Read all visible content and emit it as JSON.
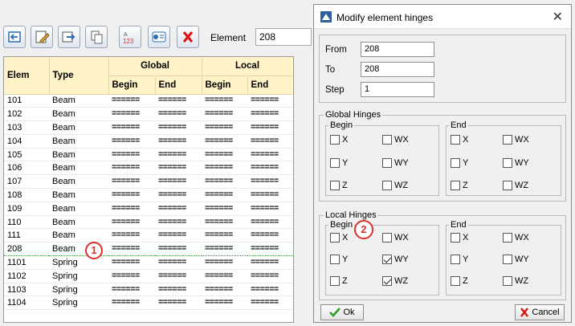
{
  "toolbar": {
    "element_label": "Element",
    "element_value": "208"
  },
  "grid": {
    "headers": {
      "elem": "Elem",
      "type": "Type",
      "global": "Global",
      "local": "Local",
      "begin": "Begin",
      "end": "End"
    },
    "rows": [
      [
        "101",
        "Beam"
      ],
      [
        "102",
        "Beam"
      ],
      [
        "103",
        "Beam"
      ],
      [
        "104",
        "Beam"
      ],
      [
        "105",
        "Beam"
      ],
      [
        "106",
        "Beam"
      ],
      [
        "107",
        "Beam"
      ],
      [
        "108",
        "Beam"
      ],
      [
        "109",
        "Beam"
      ],
      [
        "110",
        "Beam"
      ],
      [
        "111",
        "Beam"
      ],
      [
        "208",
        "Beam"
      ],
      [
        "1101",
        "Spring"
      ],
      [
        "1102",
        "Spring"
      ],
      [
        "1103",
        "Spring"
      ],
      [
        "1104",
        "Spring"
      ]
    ],
    "cell": "======",
    "selected_row": "208"
  },
  "markers": {
    "m1": "1",
    "m2": "2"
  },
  "dialog": {
    "title": "Modify element hinges",
    "from_label": "From",
    "from_value": "208",
    "to_label": "To",
    "to_value": "208",
    "step_label": "Step",
    "step_value": "1",
    "global_title": "Global Hinges",
    "local_title": "Local Hinges",
    "begin": "Begin",
    "end": "End",
    "x": "X",
    "y": "Y",
    "z": "Z",
    "wx": "WX",
    "wy": "WY",
    "wz": "WZ",
    "local_begin_checked": [
      "WY",
      "WZ"
    ],
    "ok": "Ok",
    "cancel": "Cancel"
  }
}
